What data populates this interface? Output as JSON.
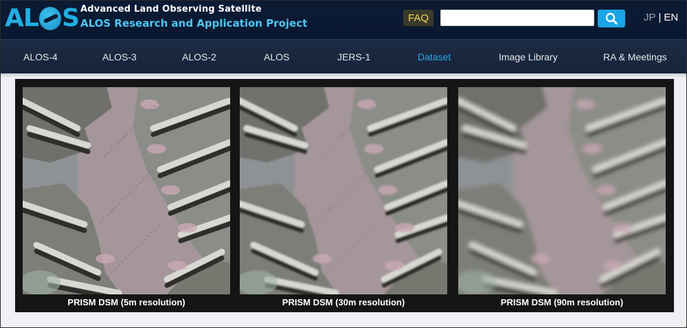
{
  "header": {
    "logo_text": "ALOS",
    "tagline": "Advanced Land Observing Satellite",
    "project": "ALOS Research and Application Project",
    "faq_label": "FAQ",
    "search_placeholder": "",
    "search_value": "",
    "lang_jp": "JP",
    "lang_sep": "|",
    "lang_en": "EN"
  },
  "nav": {
    "items": [
      {
        "label": "ALOS-4"
      },
      {
        "label": "ALOS-3"
      },
      {
        "label": "ALOS-2"
      },
      {
        "label": "ALOS"
      },
      {
        "label": "JERS-1"
      },
      {
        "label": "Dataset"
      },
      {
        "label": "Image Library"
      },
      {
        "label": "RA & Meetings"
      }
    ],
    "active": "Dataset"
  },
  "content": {
    "images": [
      {
        "caption": "PRISM DSM (5m resolution)",
        "blur": 0
      },
      {
        "caption": "PRISM DSM (30m resolution)",
        "blur": 1.2
      },
      {
        "caption": "PRISM DSM (90m resolution)",
        "blur": 3.2
      }
    ]
  },
  "colors": {
    "header_bg": "#0c1b35",
    "nav_bg": "#1c2b44",
    "accent": "#2aa8e6",
    "faq_text": "#f4d45a"
  }
}
